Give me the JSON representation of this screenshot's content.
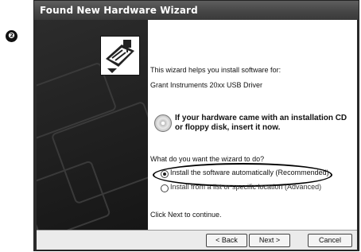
{
  "step_badge": "❷",
  "window": {
    "title": "Found New Hardware Wizard"
  },
  "content": {
    "intro": "This wizard helps you install software for:",
    "device": "Grant Instruments 20xx USB Driver",
    "note_line1": "If your hardware came with an installation CD",
    "note_line2": "or floppy disk, insert it now.",
    "question": "What do you want the wizard to do?",
    "options": [
      {
        "label": "Install the software automatically (Recommended)",
        "selected": true
      },
      {
        "label": "Install from a list or specific location (Advanced)",
        "selected": false
      }
    ],
    "footer": "Click Next to continue."
  },
  "buttons": {
    "back": "< Back",
    "next": "Next >",
    "cancel": "Cancel"
  }
}
